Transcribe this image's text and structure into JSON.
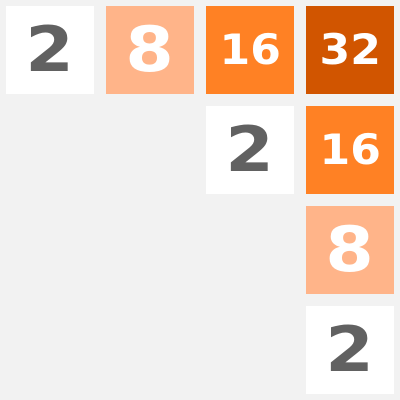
{
  "board": {
    "tiles": [
      {
        "row": 0,
        "col": 0,
        "value": "2"
      },
      {
        "row": 0,
        "col": 1,
        "value": "8"
      },
      {
        "row": 0,
        "col": 2,
        "value": "16"
      },
      {
        "row": 0,
        "col": 3,
        "value": "32"
      },
      {
        "row": 1,
        "col": 2,
        "value": "2"
      },
      {
        "row": 1,
        "col": 3,
        "value": "16"
      },
      {
        "row": 2,
        "col": 3,
        "value": "8"
      },
      {
        "row": 3,
        "col": 3,
        "value": "2"
      }
    ]
  },
  "colors": {
    "background": "#f2f2f2",
    "tile_2": "#ffffff",
    "tile_8": "#ffb489",
    "tile_16": "#ff8124",
    "tile_32": "#d15500",
    "dark_text": "#616161",
    "light_text": "#ffffff"
  }
}
